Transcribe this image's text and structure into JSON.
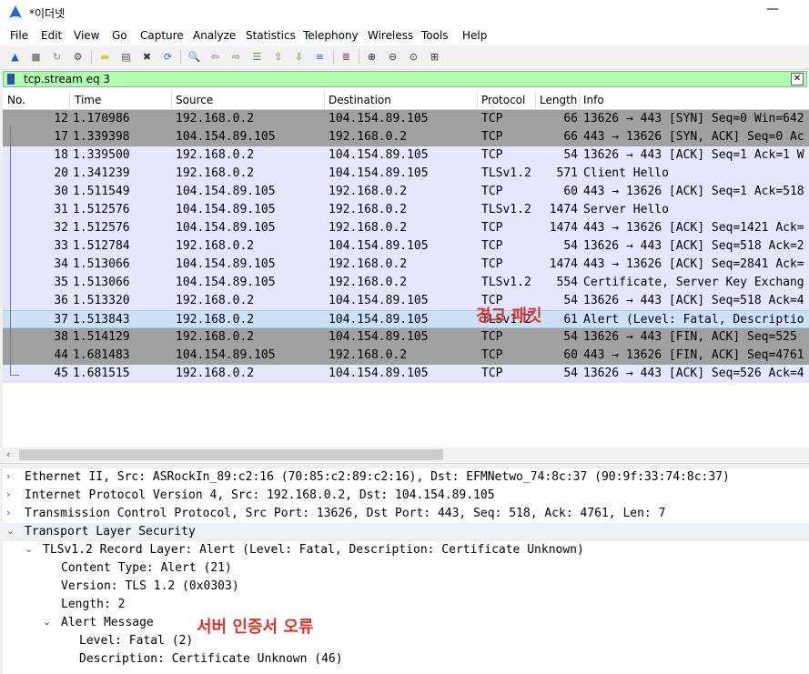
{
  "window": {
    "title": "*이더넷",
    "minimize_glyph": "—"
  },
  "menu": [
    "File",
    "Edit",
    "View",
    "Go",
    "Capture",
    "Analyze",
    "Statistics",
    "Telephony",
    "Wireless",
    "Tools",
    "Help"
  ],
  "toolbar_icons": [
    {
      "name": "shark-fin-start-icon",
      "glyph": "▲",
      "color": "#1f5cc4"
    },
    {
      "name": "stop-capture-icon",
      "glyph": "■",
      "color": "#8a8a8a"
    },
    {
      "name": "restart-capture-icon",
      "glyph": "↻",
      "color": "#8a8a8a"
    },
    {
      "name": "capture-options-icon",
      "glyph": "⚙",
      "color": "#444444"
    },
    {
      "name": "open-file-icon",
      "glyph": "▬",
      "color": "#f0c040"
    },
    {
      "name": "save-file-icon",
      "glyph": "▤",
      "color": "#555555"
    },
    {
      "name": "close-file-icon",
      "glyph": "✖",
      "color": "#333333"
    },
    {
      "name": "reload-file-icon",
      "glyph": "⟳",
      "color": "#2a66c8"
    },
    {
      "name": "find-packet-icon",
      "glyph": "🔍",
      "color": "#333333"
    },
    {
      "name": "go-back-icon",
      "glyph": "⇦",
      "color": "#4f8f2f"
    },
    {
      "name": "go-forward-icon",
      "glyph": "⇨",
      "color": "#4f8f2f"
    },
    {
      "name": "go-to-packet-icon",
      "glyph": "☰",
      "color": "#4f8f2f"
    },
    {
      "name": "go-first-packet-icon",
      "glyph": "⇧",
      "color": "#4f8f2f"
    },
    {
      "name": "go-last-packet-icon",
      "glyph": "⇩",
      "color": "#4f8f2f"
    },
    {
      "name": "auto-scroll-icon",
      "glyph": "≡",
      "color": "#2a66c8"
    },
    {
      "name": "colorize-icon",
      "glyph": "≣",
      "color": "#c02020"
    },
    {
      "name": "zoom-in-icon",
      "glyph": "⊕",
      "color": "#333333"
    },
    {
      "name": "zoom-out-icon",
      "glyph": "⊖",
      "color": "#333333"
    },
    {
      "name": "normal-size-icon",
      "glyph": "⊙",
      "color": "#333333"
    },
    {
      "name": "resize-columns-icon",
      "glyph": "⊞",
      "color": "#333333"
    }
  ],
  "filter": {
    "value": "tcp.stream eq 3",
    "clear_glyph": "✕"
  },
  "columns": [
    "No.",
    "Time",
    "Source",
    "Destination",
    "Protocol",
    "Length",
    "Info"
  ],
  "packets": [
    {
      "no": "12",
      "time": "1.170986",
      "src": "192.168.0.2",
      "dst": "104.154.89.105",
      "proto": "TCP",
      "len": "66",
      "info": "13626 → 443 [SYN] Seq=0 Win=642",
      "style": "gray"
    },
    {
      "no": "17",
      "time": "1.339398",
      "src": "104.154.89.105",
      "dst": "192.168.0.2",
      "proto": "TCP",
      "len": "66",
      "info": "443 → 13626 [SYN, ACK] Seq=0 Ac",
      "style": "gray"
    },
    {
      "no": "18",
      "time": "1.339500",
      "src": "192.168.0.2",
      "dst": "104.154.89.105",
      "proto": "TCP",
      "len": "54",
      "info": "13626 → 443 [ACK] Seq=1 Ack=1 W",
      "style": "lav"
    },
    {
      "no": "20",
      "time": "1.341239",
      "src": "192.168.0.2",
      "dst": "104.154.89.105",
      "proto": "TLSv1.2",
      "len": "571",
      "info": "Client Hello",
      "style": "lav"
    },
    {
      "no": "30",
      "time": "1.511549",
      "src": "104.154.89.105",
      "dst": "192.168.0.2",
      "proto": "TCP",
      "len": "60",
      "info": "443 → 13626 [ACK] Seq=1 Ack=518",
      "style": "lav"
    },
    {
      "no": "31",
      "time": "1.512576",
      "src": "104.154.89.105",
      "dst": "192.168.0.2",
      "proto": "TLSv1.2",
      "len": "1474",
      "info": "Server Hello",
      "style": "lav"
    },
    {
      "no": "32",
      "time": "1.512576",
      "src": "104.154.89.105",
      "dst": "192.168.0.2",
      "proto": "TCP",
      "len": "1474",
      "info": "443 → 13626 [ACK] Seq=1421 Ack=",
      "style": "lav"
    },
    {
      "no": "33",
      "time": "1.512784",
      "src": "192.168.0.2",
      "dst": "104.154.89.105",
      "proto": "TCP",
      "len": "54",
      "info": "13626 → 443 [ACK] Seq=518 Ack=2",
      "style": "lav"
    },
    {
      "no": "34",
      "time": "1.513066",
      "src": "104.154.89.105",
      "dst": "192.168.0.2",
      "proto": "TCP",
      "len": "1474",
      "info": "443 → 13626 [ACK] Seq=2841 Ack=",
      "style": "lav"
    },
    {
      "no": "35",
      "time": "1.513066",
      "src": "104.154.89.105",
      "dst": "192.168.0.2",
      "proto": "TLSv1.2",
      "len": "554",
      "info": "Certificate, Server Key Exchang",
      "style": "lav"
    },
    {
      "no": "36",
      "time": "1.513320",
      "src": "192.168.0.2",
      "dst": "104.154.89.105",
      "proto": "TCP",
      "len": "54",
      "info": "13626 → 443 [ACK] Seq=518 Ack=4",
      "style": "lav"
    },
    {
      "no": "37",
      "time": "1.513843",
      "src": "192.168.0.2",
      "dst": "104.154.89.105",
      "proto": "TLSv1.2",
      "len": "61",
      "info": "Alert (Level: Fatal, Descriptio",
      "style": "sel"
    },
    {
      "no": "38",
      "time": "1.514129",
      "src": "192.168.0.2",
      "dst": "104.154.89.105",
      "proto": "TCP",
      "len": "54",
      "info": "13626 → 443 [FIN, ACK] Seq=525",
      "style": "gray"
    },
    {
      "no": "44",
      "time": "1.681483",
      "src": "104.154.89.105",
      "dst": "192.168.0.2",
      "proto": "TCP",
      "len": "60",
      "info": "443 → 13626 [FIN, ACK] Seq=4761",
      "style": "gray"
    },
    {
      "no": "45",
      "time": "1.681515",
      "src": "192.168.0.2",
      "dst": "104.154.89.105",
      "proto": "TCP",
      "len": "54",
      "info": "13626 → 443 [ACK] Seq=526 Ack=4",
      "style": "lav"
    }
  ],
  "annotations": {
    "packet_note": "경고 패킷",
    "detail_note": "서버 인증서 오류"
  },
  "details": [
    {
      "indent": 0,
      "arrow": "›",
      "text": "Ethernet II, Src: ASRockIn_89:c2:16 (70:85:c2:89:c2:16), Dst: EFMNetwo_74:8c:37 (90:9f:33:74:8c:37)"
    },
    {
      "indent": 0,
      "arrow": "›",
      "text": "Internet Protocol Version 4, Src: 192.168.0.2, Dst: 104.154.89.105"
    },
    {
      "indent": 0,
      "arrow": "›",
      "text": "Transmission Control Protocol, Src Port: 13626, Dst Port: 443, Seq: 518, Ack: 4761, Len: 7"
    },
    {
      "indent": 0,
      "arrow": "⌄",
      "text": "Transport Layer Security",
      "selected": true
    },
    {
      "indent": 1,
      "arrow": "⌄",
      "text": "TLSv1.2 Record Layer: Alert (Level: Fatal, Description: Certificate Unknown)"
    },
    {
      "indent": 2,
      "arrow": "",
      "text": "Content Type: Alert (21)"
    },
    {
      "indent": 2,
      "arrow": "",
      "text": "Version: TLS 1.2 (0x0303)"
    },
    {
      "indent": 2,
      "arrow": "",
      "text": "Length: 2"
    },
    {
      "indent": 2,
      "arrow": "⌄",
      "text": "Alert Message"
    },
    {
      "indent": 3,
      "arrow": "",
      "text": "Level: Fatal (2)"
    },
    {
      "indent": 3,
      "arrow": "",
      "text": "Description: Certificate Unknown (46)"
    }
  ],
  "scroll_left_glyph": "‹"
}
